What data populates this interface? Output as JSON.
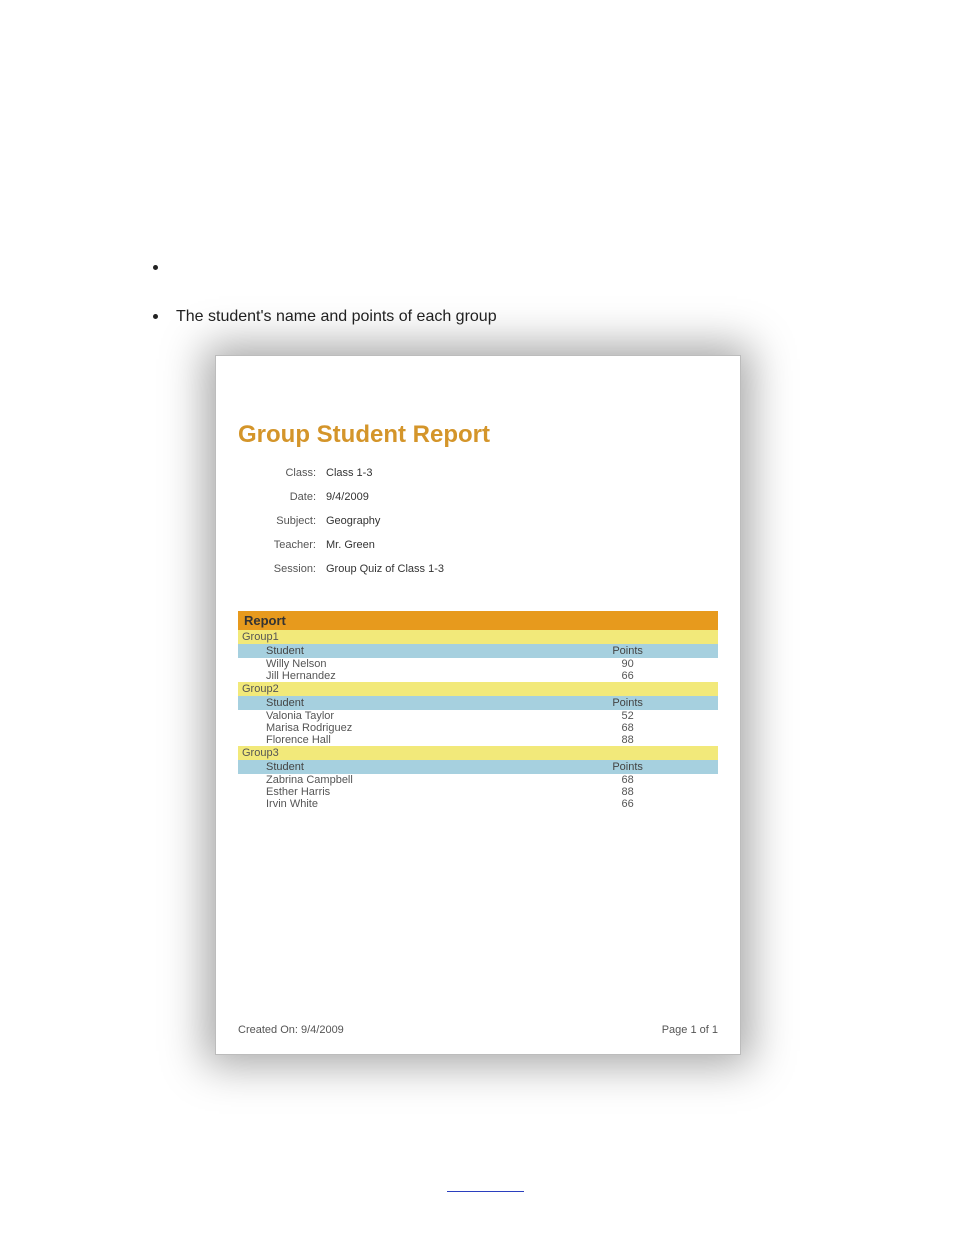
{
  "bullets": {
    "empty": "",
    "item2": "The student's name and points of each group"
  },
  "report": {
    "title": "Group Student Report",
    "meta": {
      "class_label": "Class:",
      "class_value": "Class 1-3",
      "date_label": "Date:",
      "date_value": "9/4/2009",
      "subject_label": "Subject:",
      "subject_value": "Geography",
      "teacher_label": "Teacher:",
      "teacher_value": "Mr. Green",
      "session_label": "Session:",
      "session_value": "Group Quiz of Class 1-3"
    },
    "section_header": "Report",
    "col_student": "Student",
    "col_points": "Points",
    "groups": [
      {
        "name": "Group1",
        "students": [
          {
            "name": "Willy Nelson",
            "points": "90"
          },
          {
            "name": "Jill  Hernandez",
            "points": "66"
          }
        ]
      },
      {
        "name": "Group2",
        "students": [
          {
            "name": "Valonia Taylor",
            "points": "52"
          },
          {
            "name": "Marisa Rodriguez",
            "points": "68"
          },
          {
            "name": "Florence Hall",
            "points": "88"
          }
        ]
      },
      {
        "name": "Group3",
        "students": [
          {
            "name": "Zabrina Campbell",
            "points": "68"
          },
          {
            "name": "Esther Harris",
            "points": "88"
          },
          {
            "name": "Irvin White",
            "points": "66"
          }
        ]
      }
    ],
    "footer": {
      "created_label": "Created On:",
      "created_value": "9/4/2009",
      "page_text": "Page 1 of 1"
    }
  }
}
